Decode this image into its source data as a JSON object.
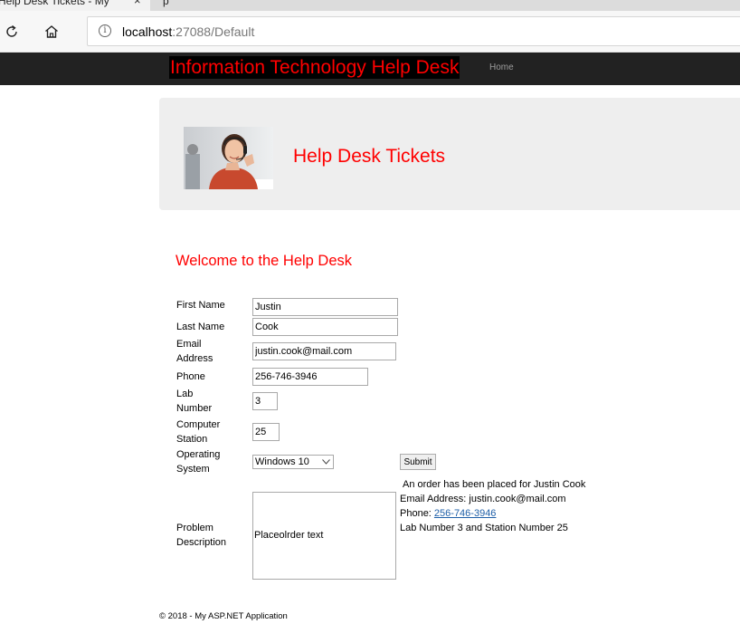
{
  "browser": {
    "tab_title": "Help Desk Tickets - My",
    "tab_close": "×",
    "next_tab_title": "p",
    "url_host": "localhost",
    "url_path": ":27088/Default",
    "info_glyph": "i",
    "icons": [
      "refresh-icon",
      "home-icon",
      "info-icon",
      "close-icon"
    ]
  },
  "navbar": {
    "brand": "Information Technology Help Desk",
    "links": [
      {
        "label": "Home"
      }
    ],
    "brand_color": "#ff0000",
    "background": "#222222"
  },
  "jumbotron": {
    "title": "Help Desk Tickets"
  },
  "welcome": "Welcome to the Help Desk",
  "form": {
    "first_name": {
      "label": "First Name",
      "value": "Justin"
    },
    "last_name": {
      "label": "Last Name",
      "value": "Cook"
    },
    "email": {
      "label_line1": "Email",
      "label_line2": "Address",
      "value": "justin.cook@mail.com"
    },
    "phone": {
      "label": "Phone",
      "value": "256-746-3946"
    },
    "lab": {
      "label_line1": "Lab",
      "label_line2": "Number",
      "value": "3"
    },
    "station": {
      "label_line1": "Computer",
      "label_line2": "Station",
      "value": "25"
    },
    "os": {
      "label_line1": "Operating",
      "label_line2": "System",
      "selected": "Windows 10"
    },
    "problem": {
      "label_line1": "Problem",
      "label_line2": "Description",
      "value": "Placeolrder text"
    },
    "submit_label": "Submit"
  },
  "result": {
    "line1": "An order has been placed for Justin Cook",
    "line2": "Email Address: justin.cook@mail.com",
    "line3_prefix": "Phone: ",
    "line3_link": "256-746-3946",
    "line4": "Lab Number 3 and Station Number 25"
  },
  "footer": "© 2018 - My ASP.NET Application"
}
